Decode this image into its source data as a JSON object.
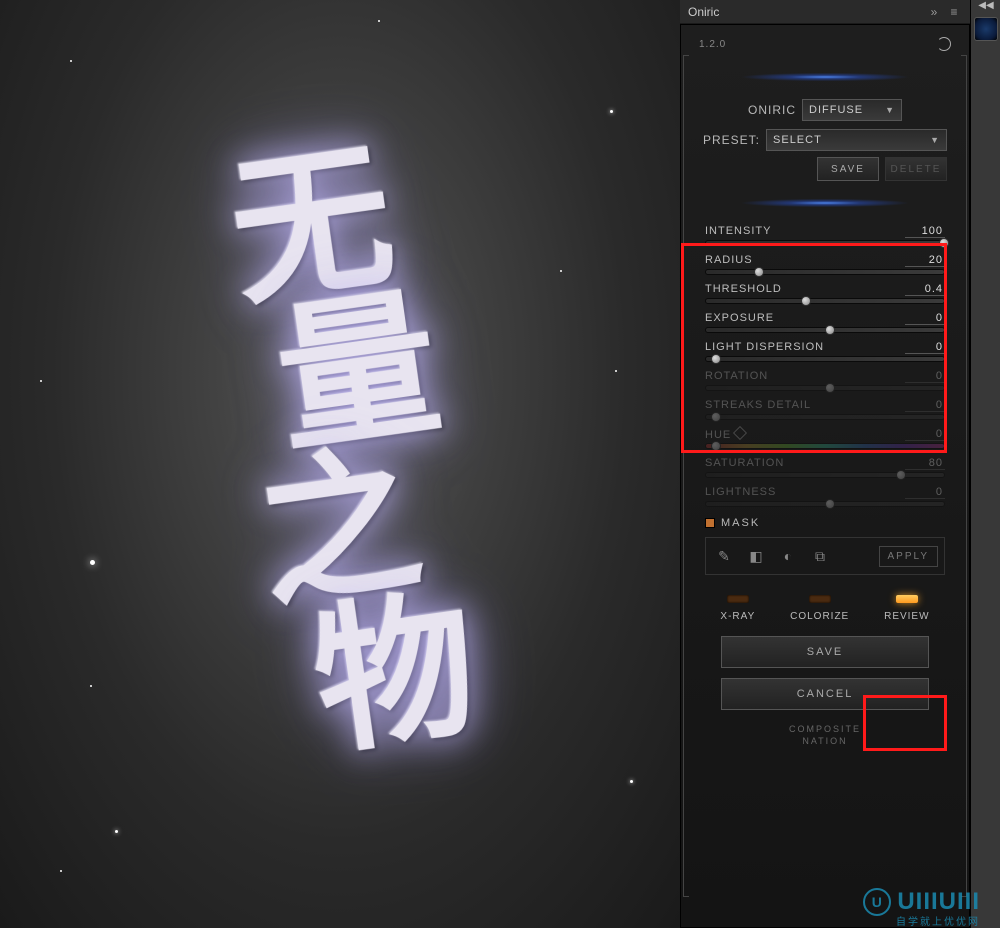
{
  "panel": {
    "title": "Oniric",
    "version": "1.2.0",
    "mode_label": "ONIRIC",
    "mode_value": "DIFFUSE",
    "preset_label": "PRESET:",
    "preset_value": "SELECT",
    "save_btn": "SAVE",
    "delete_btn": "DELETE"
  },
  "sliders": [
    {
      "label": "INTENSITY",
      "value": "100",
      "pos": 98,
      "active": true
    },
    {
      "label": "RADIUS",
      "value": "20",
      "pos": 20,
      "active": true
    },
    {
      "label": "THRESHOLD",
      "value": "0.4",
      "pos": 40,
      "active": true
    },
    {
      "label": "EXPOSURE",
      "value": "0",
      "pos": 50,
      "active": true
    },
    {
      "label": "LIGHT DISPERSION",
      "value": "0",
      "pos": 2,
      "active": true
    },
    {
      "label": "ROTATION",
      "value": "0",
      "pos": 50,
      "active": false
    },
    {
      "label": "STREAKS DETAIL",
      "value": "0",
      "pos": 2,
      "active": false
    },
    {
      "label": "HUE",
      "value": "0",
      "pos": 2,
      "active": false,
      "hue": true,
      "eyedrop": true
    },
    {
      "label": "SATURATION",
      "value": "80",
      "pos": 80,
      "active": false
    },
    {
      "label": "LIGHTNESS",
      "value": "0",
      "pos": 50,
      "active": false
    }
  ],
  "mask": {
    "label": "MASK",
    "apply": "APPLY"
  },
  "toggles": [
    {
      "label": "X-RAY",
      "on": false
    },
    {
      "label": "COLORIZE",
      "on": false
    },
    {
      "label": "REVIEW",
      "on": true
    }
  ],
  "actions": {
    "save": "SAVE",
    "cancel": "CANCEL"
  },
  "footer": {
    "line1": "COMPOSITE",
    "line2": "NATION"
  },
  "watermark": {
    "text": "UIIIUIII",
    "sub": "自学就上优优网"
  },
  "canvas_text": [
    "无",
    "量",
    "之",
    "物"
  ]
}
